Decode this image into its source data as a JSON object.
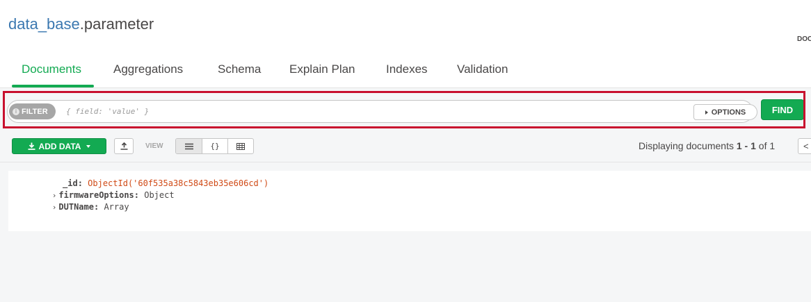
{
  "namespace": {
    "database": "data_base",
    "collection": ".parameter",
    "doc_count_label": "DOC"
  },
  "tabs": [
    "Documents",
    "Aggregations",
    "Schema",
    "Explain Plan",
    "Indexes",
    "Validation"
  ],
  "query": {
    "filter_badge": "FILTER",
    "filter_placeholder": "{ field: 'value' }",
    "options_label": "OPTIONS",
    "find_label": "FIND"
  },
  "toolbar": {
    "add_data_label": "ADD DATA",
    "view_label": "VIEW",
    "views": [
      "list",
      "json",
      "table"
    ],
    "displaying_prefix": "Displaying documents ",
    "range_start": "1",
    "range_sep": " - ",
    "range_end": "1",
    "of_label": " of ",
    "total": "1",
    "prev_label": "<"
  },
  "document": {
    "fields": [
      {
        "key": "_id",
        "value": "ObjectId('60f535a38c5843eb35e606cd')",
        "expandable": false
      },
      {
        "key": "firmwareOptions",
        "value": "Object",
        "expandable": true
      },
      {
        "key": "DUTName",
        "value": "Array",
        "expandable": true
      }
    ]
  },
  "colors": {
    "accent": "#13aa52",
    "database_link": "#3b78b0",
    "highlight_box": "#c8102e",
    "object_id": "#d04a16"
  }
}
